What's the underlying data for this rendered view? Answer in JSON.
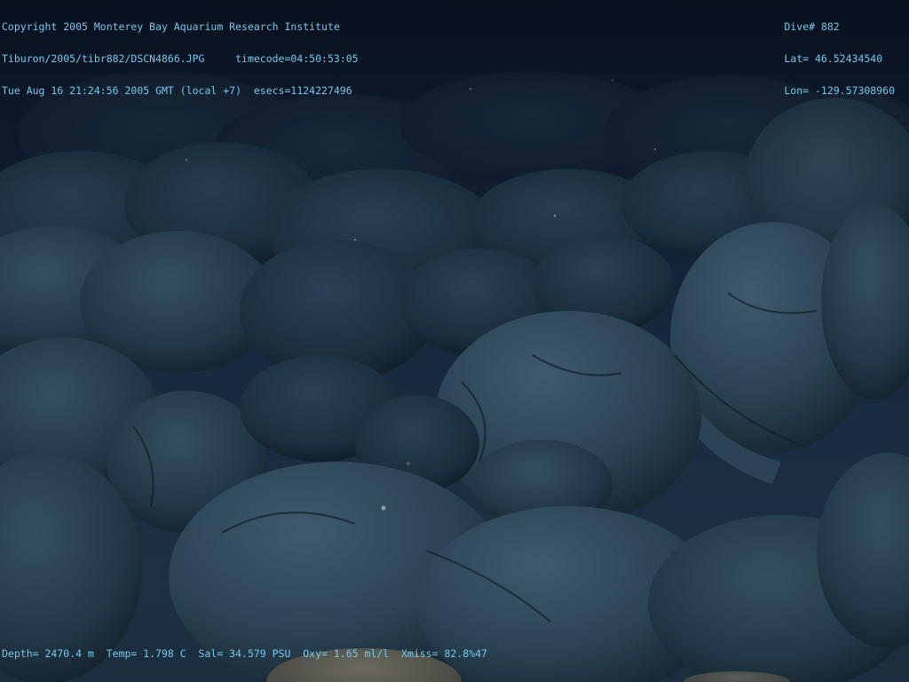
{
  "overlay": {
    "top_left": [
      "Copyright 2005 Monterey Bay Aquarium Research Institute",
      "Tiburon/2005/tibr882/DSCN4866.JPG     timecode=04:50:53:05",
      "Tue Aug 16 21:24:56 2005 GMT (local +7)  esecs=1124227496"
    ],
    "top_right": [
      "Dive# 882",
      "Lat= 46.52434540",
      "Lon= -129.57308960"
    ],
    "bottom": "Depth= 2470.4 m  Temp= 1.798 C  Sal= 34.579 PSU  Oxy= 1.65 ml/l  Xmiss= 82.8%47"
  },
  "colors": {
    "overlay_text": "#79c8e8",
    "water": "#0e1a2a",
    "rock_dark": "#1c2f3f",
    "rock_light": "#3a5466"
  }
}
